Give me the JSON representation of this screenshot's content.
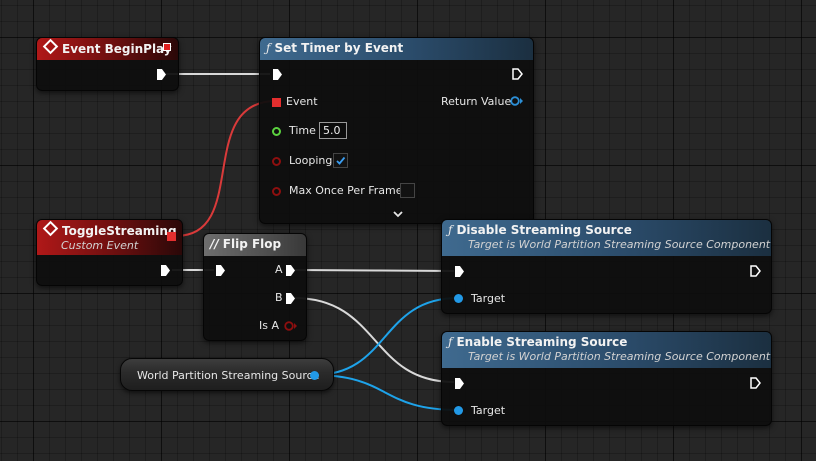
{
  "nodes": {
    "event_begin_play": {
      "title": "Event BeginPlay"
    },
    "set_timer": {
      "title": "Set Timer by Event",
      "event_label": "Event",
      "return_label": "Return Value",
      "time_label": "Time",
      "time_value": "5.0",
      "looping_label": "Looping",
      "looping_checked": true,
      "max_once_label": "Max Once Per Frame",
      "max_once_checked": false
    },
    "toggle_streaming": {
      "title": "ToggleStreaming",
      "subtitle": "Custom Event"
    },
    "flip_flop": {
      "title": "Flip Flop",
      "a_label": "A",
      "b_label": "B",
      "is_a_label": "Is A"
    },
    "disable_streaming": {
      "title": "Disable Streaming Source",
      "subtitle": "Target is World Partition Streaming Source Component",
      "target_label": "Target"
    },
    "enable_streaming": {
      "title": "Enable Streaming Source",
      "subtitle": "Target is World Partition Streaming Source Component",
      "target_label": "Target"
    },
    "streaming_source_var": {
      "label": "World Partition Streaming Source"
    }
  },
  "colors": {
    "exec_wire": "#d9d9d9",
    "object_wire": "#1ea3ea",
    "delegate_wire": "#d93a3a",
    "event_header": "#b01818",
    "function_header": "#3f6a8f"
  },
  "icons": {
    "function": "function-icon",
    "event": "event-diamond-icon",
    "flipflop": "flipflop-macro-icon",
    "expand": "chevron-down-icon"
  }
}
